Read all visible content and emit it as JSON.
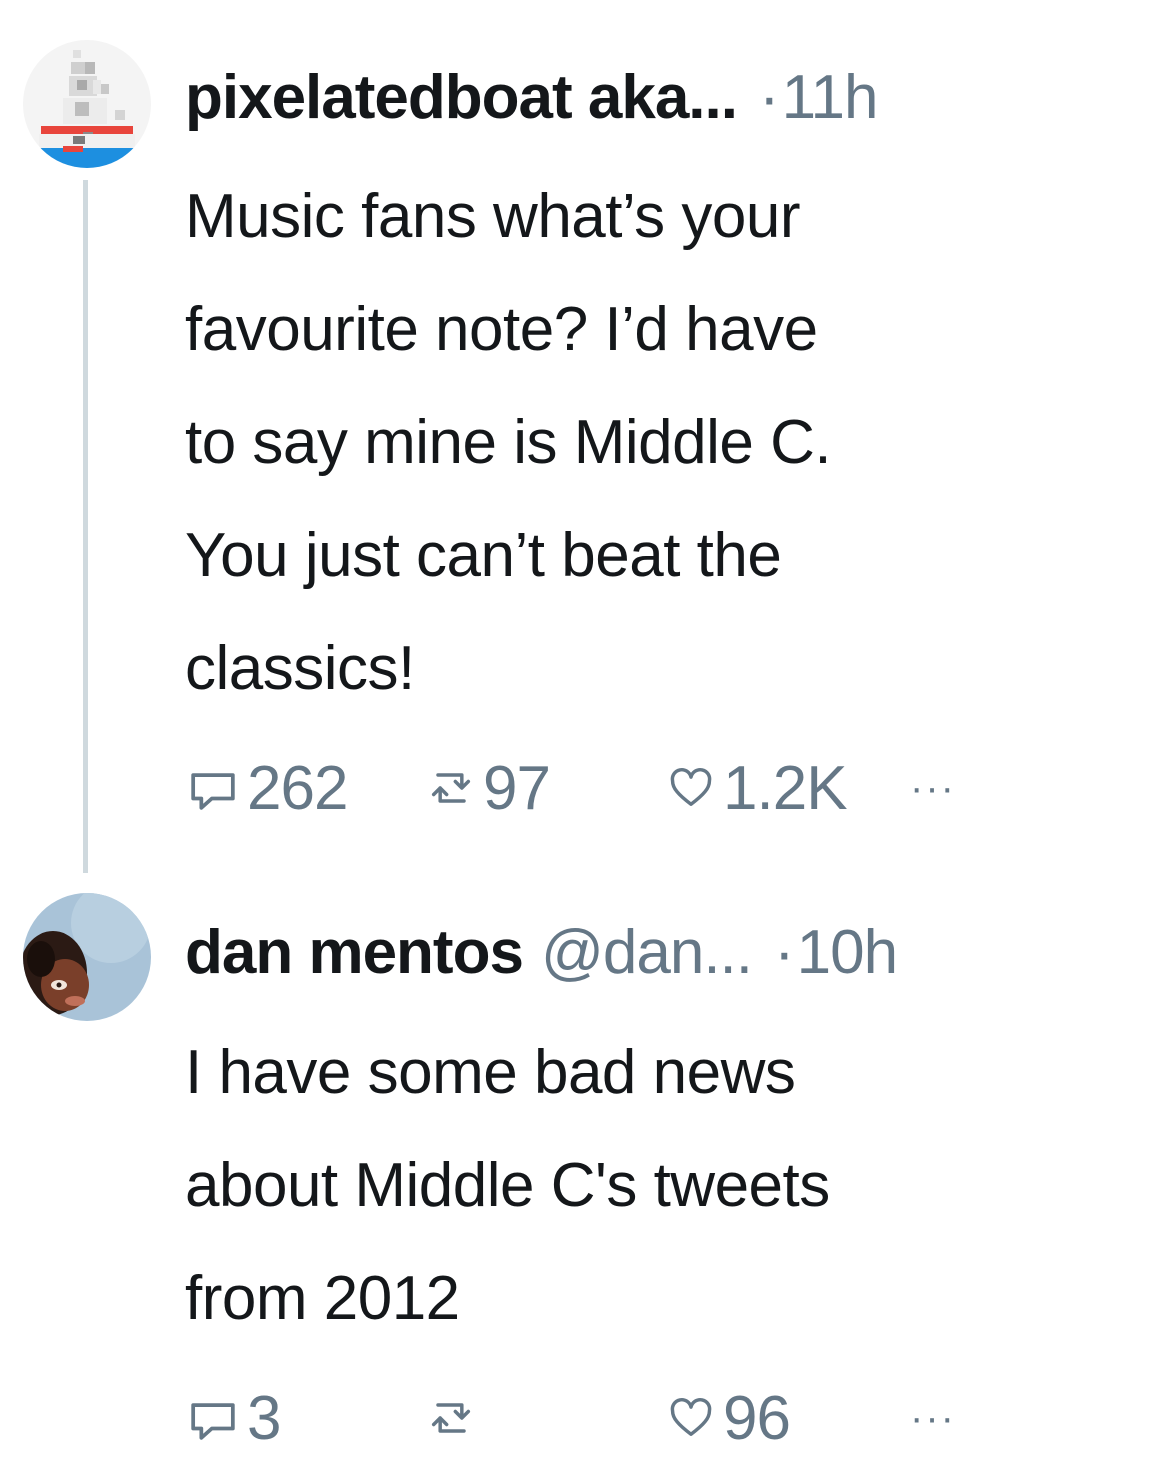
{
  "tweets": [
    {
      "author_name": "pixelatedboat aka...",
      "handle": "",
      "separator": "·",
      "time": "11h",
      "text": "Music fans what’s your\nfavourite note? I’d have\nto say mine is Middle C.\nYou just can’t beat the\nclassics!",
      "replies": "262",
      "retweets": "97",
      "likes": "1.2K",
      "more": "···",
      "avatar_icon": "pixel-boat-avatar"
    },
    {
      "author_name": "dan mentos",
      "handle": "@dan...",
      "separator": "·",
      "time": "10h",
      "text": "I have some bad news\nabout Middle C's tweets\nfrom 2012",
      "replies": "3",
      "retweets": "",
      "likes": "96",
      "more": "···",
      "avatar_icon": "user-photo-avatar"
    }
  ],
  "colors": {
    "text": "#14171a",
    "secondary": "#657786",
    "thread_line": "#cfd9de"
  },
  "icons": {
    "reply": "reply-icon",
    "retweet": "retweet-icon",
    "like": "heart-icon",
    "more": "more-options-icon"
  }
}
